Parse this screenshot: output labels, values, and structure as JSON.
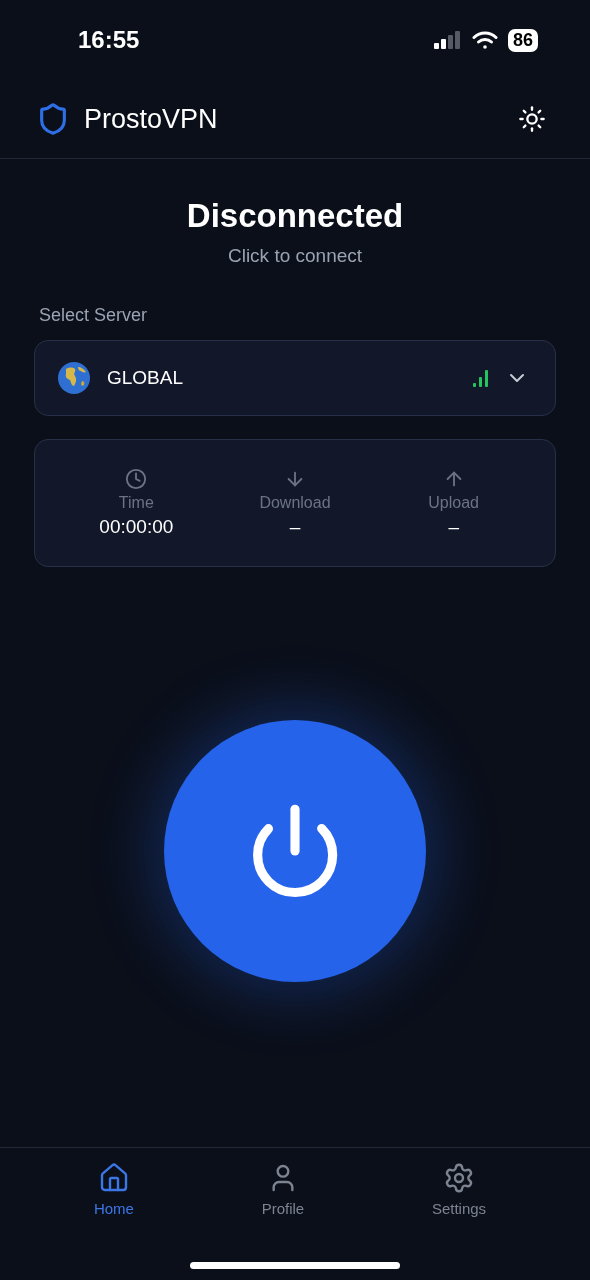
{
  "status_bar": {
    "time": "16:55",
    "battery": "86"
  },
  "header": {
    "title": "ProstoVPN"
  },
  "connection": {
    "status": "Disconnected",
    "hint": "Click to connect"
  },
  "server": {
    "label": "Select Server",
    "name": "GLOBAL"
  },
  "stats": [
    {
      "kind": "time",
      "label": "Time",
      "value": "00:00:00"
    },
    {
      "kind": "download",
      "label": "Download",
      "value": "–"
    },
    {
      "kind": "upload",
      "label": "Upload",
      "value": "–"
    }
  ],
  "tabs": [
    {
      "kind": "home",
      "label": "Home",
      "selected": true
    },
    {
      "kind": "profile",
      "label": "Profile",
      "selected": false
    },
    {
      "kind": "settings",
      "label": "Settings",
      "selected": false
    }
  ]
}
